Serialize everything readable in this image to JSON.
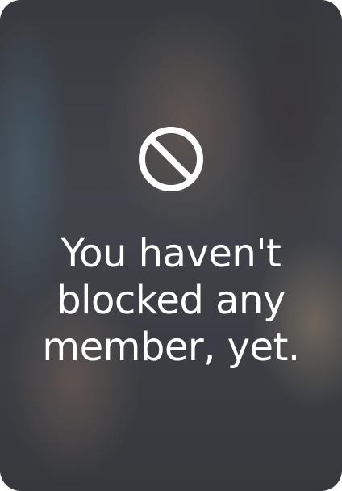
{
  "empty_state": {
    "icon": "block-icon",
    "message_lines": [
      "You haven't",
      "blocked any",
      "member, yet."
    ]
  },
  "colors": {
    "text": "#ffffff",
    "icon": "#ffffff"
  }
}
